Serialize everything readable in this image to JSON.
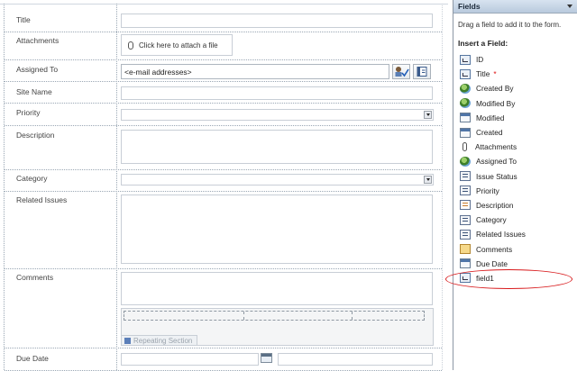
{
  "form": {
    "rows": [
      {
        "label": "Title"
      },
      {
        "label": "Attachments"
      },
      {
        "label": "Assigned To"
      },
      {
        "label": "Site Name"
      },
      {
        "label": "Priority"
      },
      {
        "label": "Description"
      },
      {
        "label": "Category"
      },
      {
        "label": "Related Issues"
      },
      {
        "label": "Comments"
      },
      {
        "label": "Due Date"
      }
    ],
    "attach_label": "Click here to attach a file",
    "assigned_to_placeholder": "<e-mail addresses>",
    "repeating_section_label": "Repeating Section"
  },
  "panel": {
    "title": "Fields",
    "help": "Drag a field to add it to the form.",
    "insert_heading": "Insert a Field:",
    "fields": [
      {
        "label": "ID",
        "icon": "text-field-icon"
      },
      {
        "label": "Title",
        "icon": "text-field-icon",
        "required": "*"
      },
      {
        "label": "Created By",
        "icon": "person-icon"
      },
      {
        "label": "Modified By",
        "icon": "person-icon"
      },
      {
        "label": "Modified",
        "icon": "date-icon"
      },
      {
        "label": "Created",
        "icon": "date-icon"
      },
      {
        "label": "Attachments",
        "icon": "paperclip-icon"
      },
      {
        "label": "Assigned To",
        "icon": "person-icon"
      },
      {
        "label": "Issue Status",
        "icon": "choice-icon"
      },
      {
        "label": "Priority",
        "icon": "choice-icon"
      },
      {
        "label": "Description",
        "icon": "multiline-icon"
      },
      {
        "label": "Category",
        "icon": "choice-icon"
      },
      {
        "label": "Related Issues",
        "icon": "choice-icon"
      },
      {
        "label": "Comments",
        "icon": "note-icon"
      },
      {
        "label": "Due Date",
        "icon": "date-icon"
      },
      {
        "label": "field1",
        "icon": "text-field-icon"
      }
    ],
    "highlight_color": "#d8191b"
  }
}
